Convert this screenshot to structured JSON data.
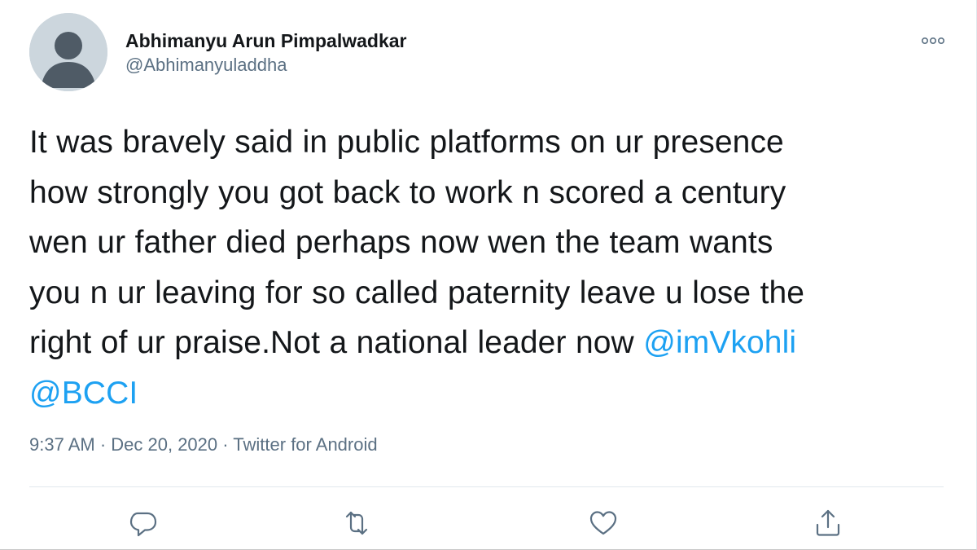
{
  "author": {
    "display_name": "Abhimanyu Arun Pimpalwadkar",
    "handle": "@Abhimanyuladdha"
  },
  "tweet": {
    "lines": [
      "It was bravely said in public platforms on ur presence",
      "how strongly you got back to work n scored a century",
      "wen ur father died perhaps now wen the team wants",
      "you n ur leaving for so called paternity leave u lose the",
      "right of ur praise.Not a national leader now "
    ],
    "mention_1": "@imVkohli",
    "mention_2": "@BCCI"
  },
  "meta": {
    "text": "9:37 AM · Dec 20, 2020 · Twitter for Android"
  },
  "icons": {
    "more": "more-options-icon",
    "reply": "reply-icon",
    "retweet": "retweet-icon",
    "like": "like-icon",
    "share": "share-icon"
  },
  "colors": {
    "mention": "#1da1f2",
    "secondary_text": "#5b7083",
    "primary_text": "#14171a",
    "icon": "#5b7083"
  }
}
